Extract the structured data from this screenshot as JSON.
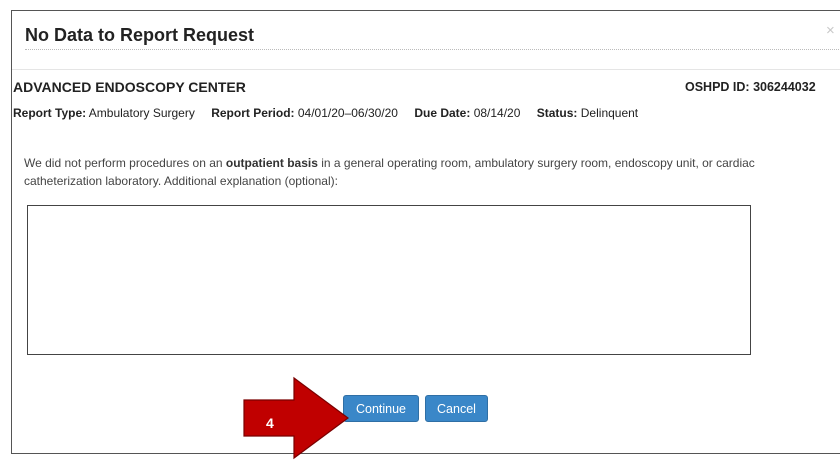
{
  "dialog": {
    "title": "No Data to Report Request",
    "close_glyph": "×"
  },
  "facility": {
    "name": "ADVANCED ENDOSCOPY CENTER",
    "oshpd_label": "OSHPD ID:",
    "oshpd_id": "306244032"
  },
  "meta": {
    "report_type_label": "Report Type:",
    "report_type": "Ambulatory Surgery",
    "report_period_label": "Report Period:",
    "report_period": "04/01/20–06/30/20",
    "due_date_label": "Due Date:",
    "due_date": "08/14/20",
    "status_label": "Status:",
    "status": "Delinquent"
  },
  "explanation": {
    "part1": "We did not perform procedures on an ",
    "bold": "outpatient basis",
    "part2": " in a general operating room, ambulatory surgery room, endoscopy unit, or cardiac catheterization laboratory. Additional explanation (optional):"
  },
  "textarea": {
    "value": ""
  },
  "buttons": {
    "continue_label": "Continue",
    "cancel_label": "Cancel"
  },
  "callout": {
    "number": "4",
    "color": "#c00000",
    "icon": "arrow-right-icon"
  },
  "colors": {
    "button_bg": "#3a87c8",
    "callout_fill": "#c00000"
  }
}
